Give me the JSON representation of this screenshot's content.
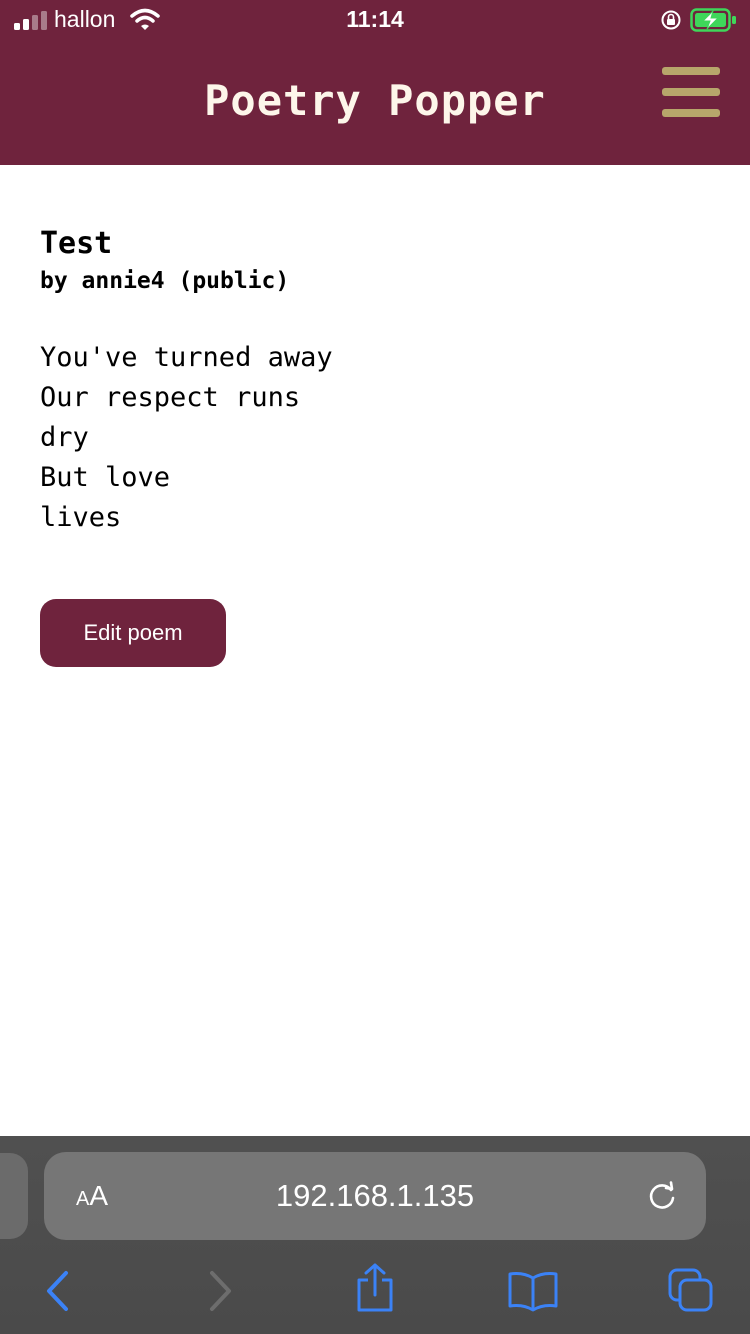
{
  "status_bar": {
    "carrier": "hallon",
    "time": "11:14",
    "icons": [
      "signal-icon",
      "wifi-icon",
      "rotation-lock-icon",
      "battery-charging-icon"
    ]
  },
  "header": {
    "title": "Poetry Popper",
    "menu_icon": "hamburger-menu-icon"
  },
  "poem": {
    "title": "Test",
    "byline": "by annie4 (public)",
    "lines": [
      "You've turned away",
      "Our respect runs",
      "dry",
      "But love",
      "lives"
    ]
  },
  "actions": {
    "edit_label": "Edit poem"
  },
  "browser": {
    "text_size_small": "A",
    "text_size_large": "A",
    "url": "192.168.1.135",
    "toolbar_icons": [
      "back-icon",
      "forward-icon",
      "share-icon",
      "bookmarks-icon",
      "tabs-icon"
    ]
  },
  "colors": {
    "brand": "#6f233d",
    "menu_icon": "#b7a66b",
    "title_text": "#fdf6ea",
    "browser_accent": "#3b82f6"
  }
}
